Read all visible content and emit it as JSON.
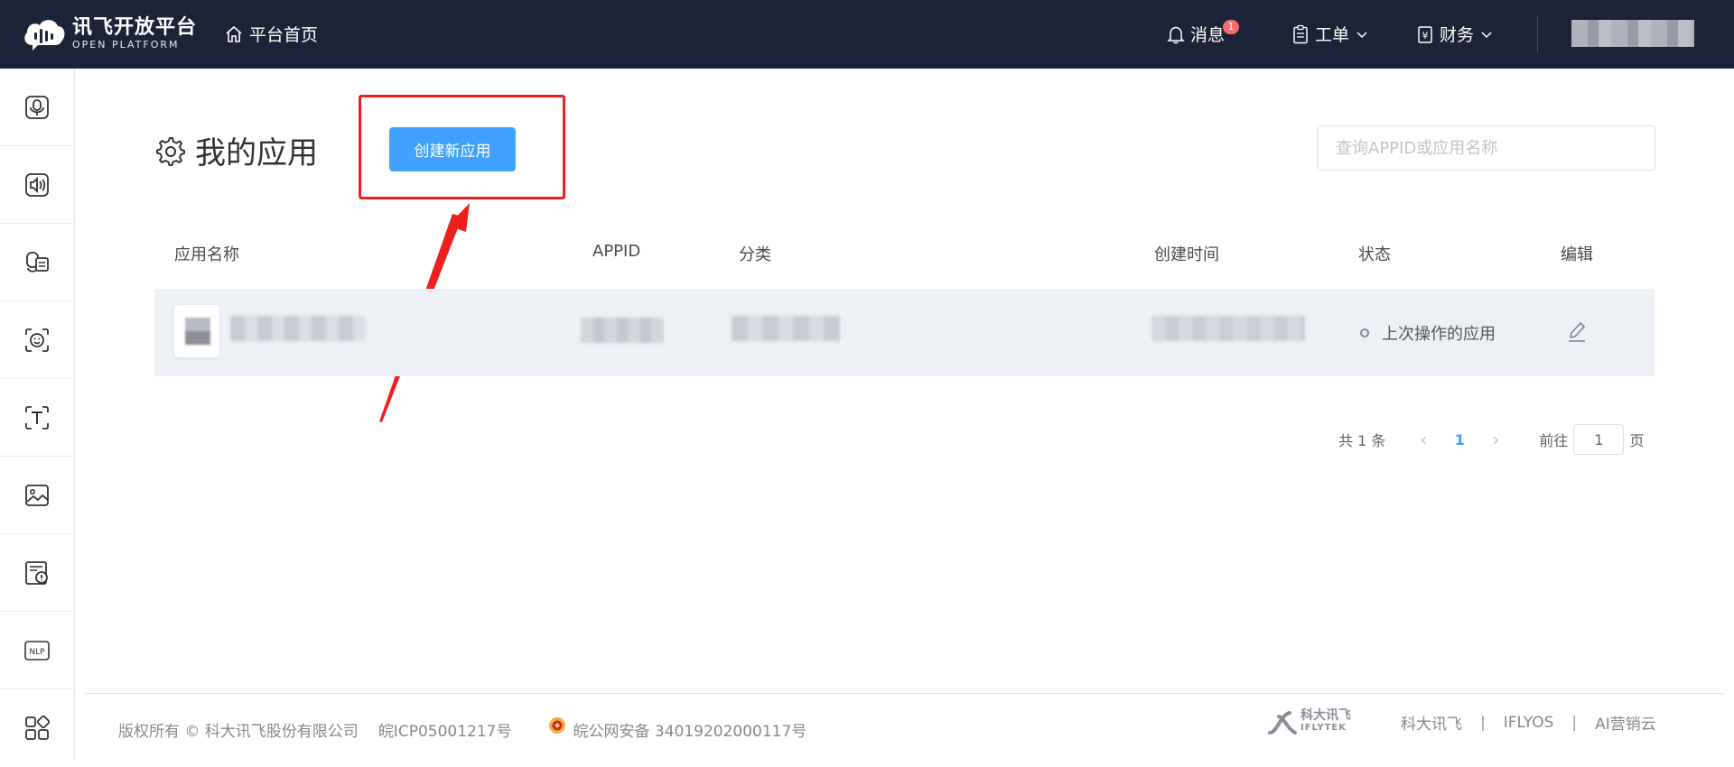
{
  "header": {
    "logo_cn": "讯飞开放平台",
    "logo_en": "OPEN PLATFORM",
    "home_label": "平台首页",
    "messages_label": "消息",
    "messages_badge": "1",
    "ticket_label": "工单",
    "finance_label": "财务"
  },
  "sidebar": {
    "items": [
      {
        "icon": "speech-recognition-icon"
      },
      {
        "icon": "speech-synthesis-icon"
      },
      {
        "icon": "voice-interaction-icon"
      },
      {
        "icon": "face-recognition-icon"
      },
      {
        "icon": "text-recognition-icon"
      },
      {
        "icon": "image-recognition-icon"
      },
      {
        "icon": "content-audit-icon"
      },
      {
        "icon": "nlp-icon",
        "text": "NLP"
      },
      {
        "icon": "more-apps-icon"
      }
    ]
  },
  "main": {
    "title": "我的应用",
    "create_button": "创建新应用",
    "search_placeholder": "查询APPID或应用名称"
  },
  "table": {
    "columns": [
      "应用名称",
      "APPID",
      "分类",
      "创建时间",
      "状态",
      "编辑"
    ],
    "rows": [
      {
        "status": "上次操作的应用"
      }
    ]
  },
  "pagination": {
    "total": "共 1 条",
    "current_page": "1",
    "goto_label": "前往",
    "goto_value": "1",
    "page_unit": "页"
  },
  "footer": {
    "copyright": "版权所有 © 科大讯飞股份有限公司",
    "icp": "皖ICP05001217号",
    "police": "皖公网安备 34019202000117号",
    "logo_cn": "科大讯飞",
    "logo_en": "IFLYTEK",
    "links": [
      "科大讯飞",
      "IFLYOS",
      "AI营销云"
    ],
    "link_separator": "|"
  },
  "colors": {
    "header_bg": "#1c2237",
    "primary_button": "#40a2fc",
    "highlight_box": "#ee1f1f",
    "row_bg": "#edf1f6",
    "badge": "#f56c6c"
  }
}
